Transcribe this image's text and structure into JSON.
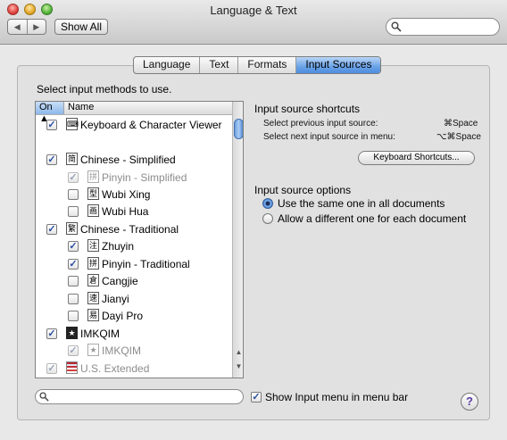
{
  "window": {
    "title": "Language & Text"
  },
  "toolbar": {
    "back": "◀",
    "forward": "▶",
    "show_all": "Show All",
    "search_value": ""
  },
  "tabs": [
    {
      "label": "Language",
      "active": false
    },
    {
      "label": "Text",
      "active": false
    },
    {
      "label": "Formats",
      "active": false
    },
    {
      "label": "Input Sources",
      "active": true
    }
  ],
  "list": {
    "instruction": "Select input methods to use.",
    "col_on": "On",
    "col_name": "Name",
    "items": [
      {
        "label": "Keyboard & Character Viewer",
        "checked": true,
        "dim": false,
        "icon": "⌨",
        "indent": 0
      },
      {
        "label": "Chinese - Simplified",
        "checked": true,
        "dim": false,
        "icon": "简",
        "indent": 0
      },
      {
        "label": "Pinyin - Simplified",
        "checked": true,
        "dim": true,
        "icon": "拼",
        "indent": 1
      },
      {
        "label": "Wubi Xing",
        "checked": false,
        "dim": false,
        "icon": "型",
        "indent": 1
      },
      {
        "label": "Wubi Hua",
        "checked": false,
        "dim": false,
        "icon": "画",
        "indent": 1
      },
      {
        "label": "Chinese - Traditional",
        "checked": true,
        "dim": false,
        "icon": "繁",
        "indent": 0
      },
      {
        "label": "Zhuyin",
        "checked": true,
        "dim": false,
        "icon": "注",
        "indent": 1
      },
      {
        "label": "Pinyin - Traditional",
        "checked": true,
        "dim": false,
        "icon": "拼",
        "indent": 1
      },
      {
        "label": "Cangjie",
        "checked": false,
        "dim": false,
        "icon": "倉",
        "indent": 1
      },
      {
        "label": "Jianyi",
        "checked": false,
        "dim": false,
        "icon": "速",
        "indent": 1
      },
      {
        "label": "Dayi Pro",
        "checked": false,
        "dim": false,
        "icon": "易",
        "indent": 1
      },
      {
        "label": "IMKQIM",
        "checked": true,
        "dim": false,
        "icon": "★",
        "indent": 0
      },
      {
        "label": "IMKQIM",
        "checked": true,
        "dim": true,
        "icon": "★",
        "indent": 1
      },
      {
        "label": "U.S. Extended",
        "checked": true,
        "dim": true,
        "icon": "flag",
        "indent": 0
      }
    ]
  },
  "shortcuts": {
    "heading": "Input source shortcuts",
    "prev_label": "Select previous input source:",
    "prev_key": "⌘Space",
    "next_label": "Select next input source in menu:",
    "next_key": "⌥⌘Space",
    "button": "Keyboard Shortcuts..."
  },
  "options": {
    "heading": "Input source options",
    "opt_same": "Use the same one in all documents",
    "opt_diff": "Allow a different one for each document",
    "selected": "same"
  },
  "bottom": {
    "search_value": "",
    "show_menu_label": "Show Input menu in menu bar",
    "show_menu_checked": true,
    "help": "?"
  }
}
